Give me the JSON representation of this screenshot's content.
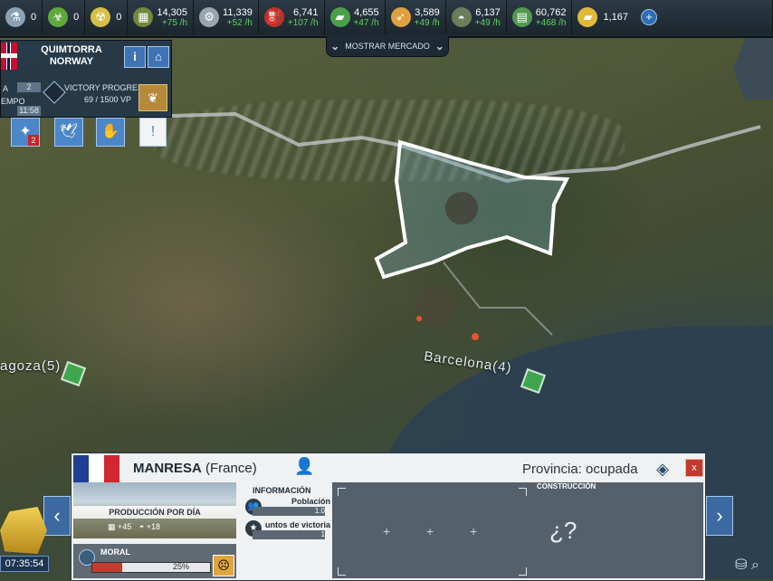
{
  "topbar": {
    "resources": [
      {
        "icon": "flask-icon",
        "glyph": "⚗",
        "color": "#8aa1b4",
        "value": "0",
        "rate": ""
      },
      {
        "icon": "biohazard-flask-icon",
        "glyph": "☣",
        "color": "#5ea83d",
        "value": "0",
        "rate": ""
      },
      {
        "icon": "nuclear-icon",
        "glyph": "☢",
        "color": "#d7c046",
        "value": "0",
        "rate": ""
      },
      {
        "icon": "ammo-crate-icon",
        "glyph": "▦",
        "color": "#6e8a3a",
        "value": "14,305",
        "rate": "+75 /h"
      },
      {
        "icon": "gear-icon",
        "glyph": "⚙",
        "color": "#9aa6ae",
        "value": "11,339",
        "rate": "+52 /h"
      },
      {
        "icon": "fuel-can-icon",
        "glyph": "⛽",
        "color": "#c0302a",
        "value": "6,741",
        "rate": "+107 /h"
      },
      {
        "icon": "cash-icon",
        "glyph": "▰",
        "color": "#4aa04a",
        "value": "4,655",
        "rate": "+47 /h"
      },
      {
        "icon": "rocket-icon",
        "glyph": "➶",
        "color": "#e0a040",
        "value": "3,589",
        "rate": "+49 /h"
      },
      {
        "icon": "helmet-icon",
        "glyph": "◓",
        "color": "#6b7e5a",
        "value": "6,137",
        "rate": "+49 /h"
      },
      {
        "icon": "money-stack-icon",
        "glyph": "▤",
        "color": "#4f9a4f",
        "value": "60,762",
        "rate": "+468 /h"
      },
      {
        "icon": "gold-bars-icon",
        "glyph": "▰",
        "color": "#e1b93a",
        "value": "1,167",
        "rate": ""
      }
    ],
    "add_label": "+"
  },
  "market": {
    "label": "MOSTRAR MERCADO"
  },
  "home_province": {
    "name_line1": "QUIMTORRA",
    "name_line2": "NORWAY",
    "info_label": "i",
    "row_a_label": "A",
    "row_a_value": "2",
    "tempo_label": "EMPO",
    "time_value": "11:58",
    "victory_label": "VICTORY PROGRESS",
    "victory_value": "69 / 1500 VP",
    "badge_count": "2"
  },
  "map": {
    "cities": [
      {
        "label": "agoza(5)"
      },
      {
        "label": "Barcelona(4)"
      }
    ]
  },
  "province_panel": {
    "name": "MANRESA",
    "country": "(France)",
    "status": "Provincia: ocupada",
    "close_label": "x",
    "production_label": "PRODUCCIÓN POR DÍA",
    "production_items": [
      "+45",
      "+18"
    ],
    "moral_label": "MORAL",
    "moral_value": "25%",
    "moral_fraction": 0.25,
    "info_header": "INFORMACIÓN",
    "population_label": "Población",
    "population_value": "1.0",
    "vp_label": "untos de victoria",
    "vp_value": "1",
    "construction_label": "CONSTRUCCIÓN",
    "unknown_label": "¿?"
  },
  "game_timer": "07:35:54",
  "colors": {
    "france_blue": "#1f3f95",
    "france_red": "#d22630",
    "panel_bg": "#f0f1f2"
  }
}
